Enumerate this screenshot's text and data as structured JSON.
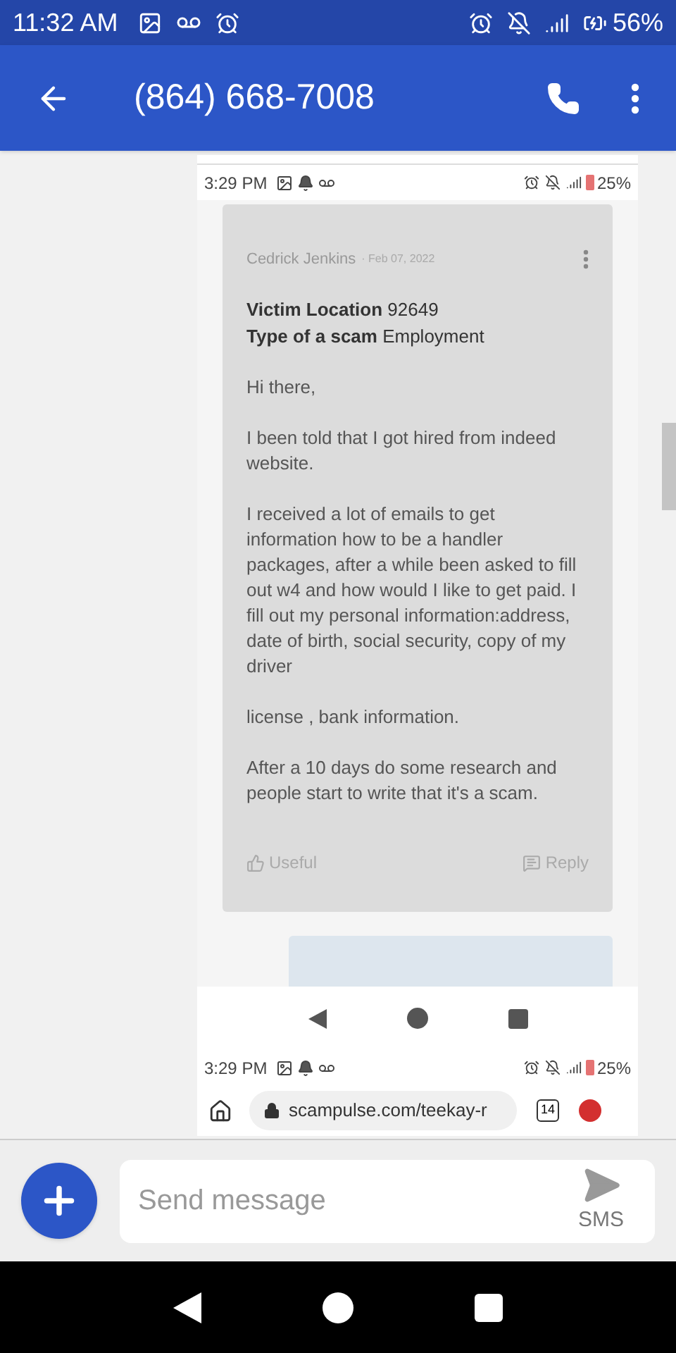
{
  "status_bar": {
    "time": "11:32 AM",
    "battery": "56%"
  },
  "app_bar": {
    "title": "(864) 668-7008"
  },
  "shared_screenshot": {
    "status_bar": {
      "time": "3:29 PM",
      "battery": "25%"
    },
    "post": {
      "author": "Cedrick Jenkins",
      "date": "· Feb 07, 2022",
      "fields": [
        "**Victim Location** 92649",
        "**Type of a scam** Employment"
      ],
      "paragraphs": [
        "Hi there,",
        "I been told that I got hired from indeed website.",
        "I received a lot of emails to get information how to be a handler packages, after a while been asked to fill out w4 and how would I like to get paid. I fill out my personal information:address, date of birth, social security, copy of my driver",
        "license , bank information.",
        "After a 10 days do some research and people start to write that it's a scam."
      ],
      "actions": [
        {
          "kind": "useful",
          "label": "Useful"
        },
        {
          "kind": "reply",
          "label": "Reply"
        }
      ]
    },
    "second_status_bar": {
      "time": "3:29 PM",
      "battery": "25%"
    },
    "browser": {
      "url": "scampulse.com/teekay-r",
      "tab_count": "14"
    }
  },
  "composer": {
    "placeholder": "Send message",
    "send_label": "SMS"
  }
}
